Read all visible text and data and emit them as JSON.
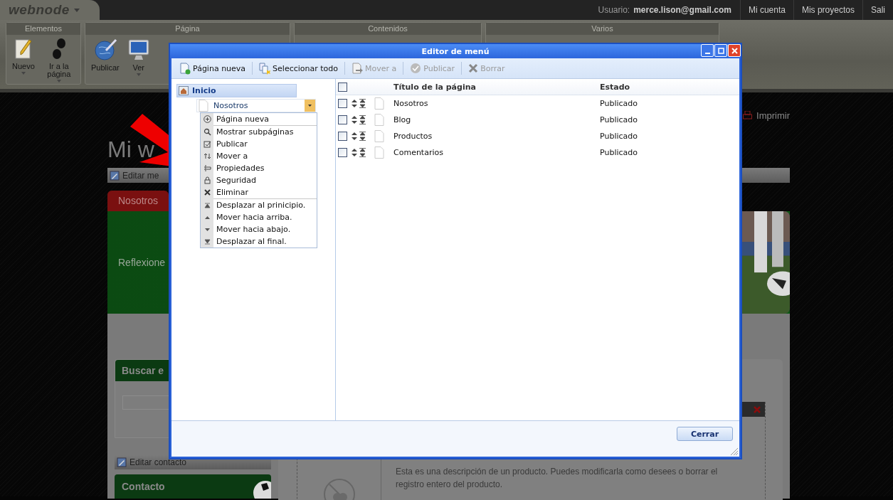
{
  "top_bar": {
    "logo": "webnode",
    "user_label": "Usuario:",
    "user_email": "merce.lison@gmail.com",
    "links": [
      "Mi cuenta",
      "Mis proyectos",
      "Sali"
    ]
  },
  "ribbon": {
    "groups": [
      {
        "title": "Elementos",
        "buttons": [
          {
            "label": "Nuevo",
            "dropdown": true
          },
          {
            "label": "Ir a la página",
            "dropdown": true
          }
        ]
      },
      {
        "title": "Página",
        "buttons": [
          {
            "label": "Publicar",
            "dropdown": false
          },
          {
            "label": "Ver",
            "dropdown": true
          }
        ]
      },
      {
        "title": "Contenidos"
      },
      {
        "title": "Varios"
      }
    ]
  },
  "site": {
    "print_link": "Imprimir",
    "title": "Mi w",
    "edit_menu": "Editar me",
    "tab": "Nosotros",
    "banner_text": "Reflexione",
    "search_title": "Buscar e",
    "edit_contact": "Editar contacto",
    "contact_title": "Contacto",
    "product_description": "Esta es una descripción de un producto. Puedes modificarla como desees o borrar el registro entero del producto."
  },
  "dialog": {
    "title": "Editor de menú",
    "toolbar": [
      {
        "label": "Página nueva",
        "disabled": false
      },
      {
        "label": "Seleccionar todo",
        "disabled": false
      },
      {
        "label": "Mover a",
        "disabled": true
      },
      {
        "label": "Publicar",
        "disabled": true
      },
      {
        "label": "Borrar",
        "disabled": true
      }
    ],
    "tree": {
      "label": "Inicio",
      "selected": true,
      "children": [
        {
          "label": "Nosotros",
          "selected": false
        }
      ]
    },
    "context_menu": {
      "groups": [
        {
          "items": [
            "Página nueva"
          ]
        },
        {
          "items": [
            "Mostrar subpáginas",
            "Publicar",
            "Mover a",
            "Propiedades",
            "Seguridad",
            "Eliminar"
          ]
        },
        {
          "items": [
            "Desplazar al prinicipio.",
            "Mover hacia arriba.",
            "Mover hacia abajo.",
            "Desplazar al final."
          ]
        }
      ]
    },
    "table": {
      "header_checked": false,
      "columns": [
        "Título de la página",
        "Estado"
      ],
      "rows": [
        {
          "title": "Nosotros",
          "status": "Publicado",
          "checked": false
        },
        {
          "title": "Blog",
          "status": "Publicado",
          "checked": false
        },
        {
          "title": "Productos",
          "status": "Publicado",
          "checked": false
        },
        {
          "title": "Comentarios",
          "status": "Publicado",
          "checked": false
        }
      ]
    },
    "close_button": "Cerrar"
  }
}
